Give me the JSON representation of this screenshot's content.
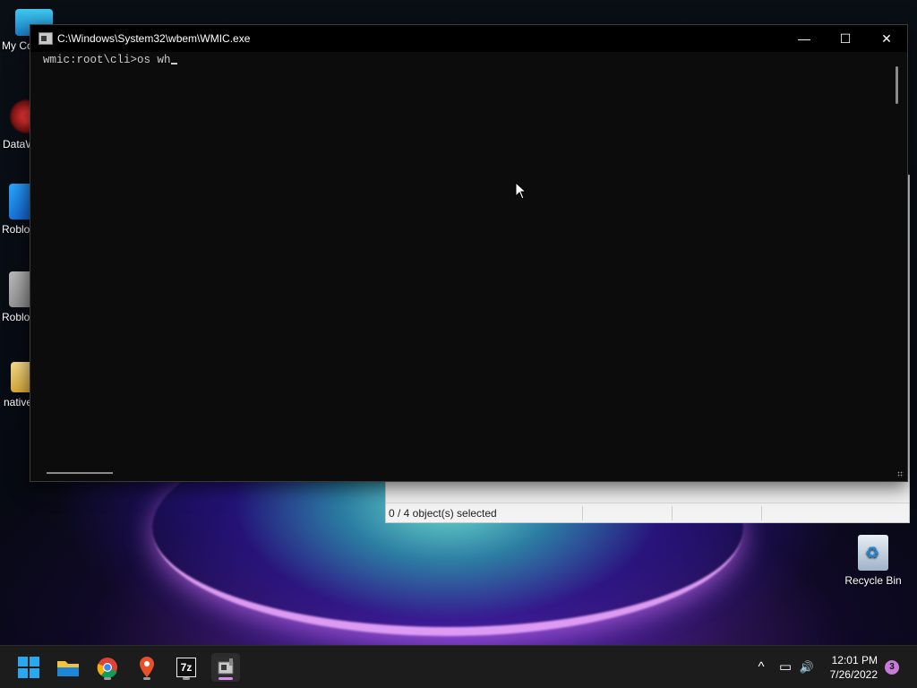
{
  "desktop": {
    "icons": [
      {
        "label": "My Co"
      },
      {
        "label": "DataW"
      },
      {
        "label": "Roblo"
      },
      {
        "label": "Roblo"
      },
      {
        "label": "native"
      },
      {
        "label": "Recycle Bin"
      }
    ]
  },
  "background_window": {
    "status_text": "0 / 4 object(s) selected"
  },
  "console": {
    "title": "C:\\Windows\\System32\\wbem\\WMIC.exe",
    "prompt": "wmic:root\\cli>",
    "command": "os wh",
    "minimize_glyph": "—",
    "maximize_glyph": "☐",
    "close_glyph": "✕"
  },
  "taskbar": {
    "apps": [
      {
        "name": "start-button"
      },
      {
        "name": "file-explorer"
      },
      {
        "name": "chrome"
      },
      {
        "name": "maps"
      },
      {
        "name": "7zip",
        "text": "7z"
      },
      {
        "name": "wmic-console"
      }
    ],
    "tray_glyphs": {
      "chevron": "^",
      "network": "▭",
      "volume": "🔊"
    },
    "time": "12:01 PM",
    "date": "7/26/2022",
    "notification_count": "3"
  },
  "colors": {
    "console_bg": "#0c0c0c",
    "console_text": "#cccccc",
    "taskbar_bg": "#1c1c1c",
    "accent": "#d98cf0"
  }
}
